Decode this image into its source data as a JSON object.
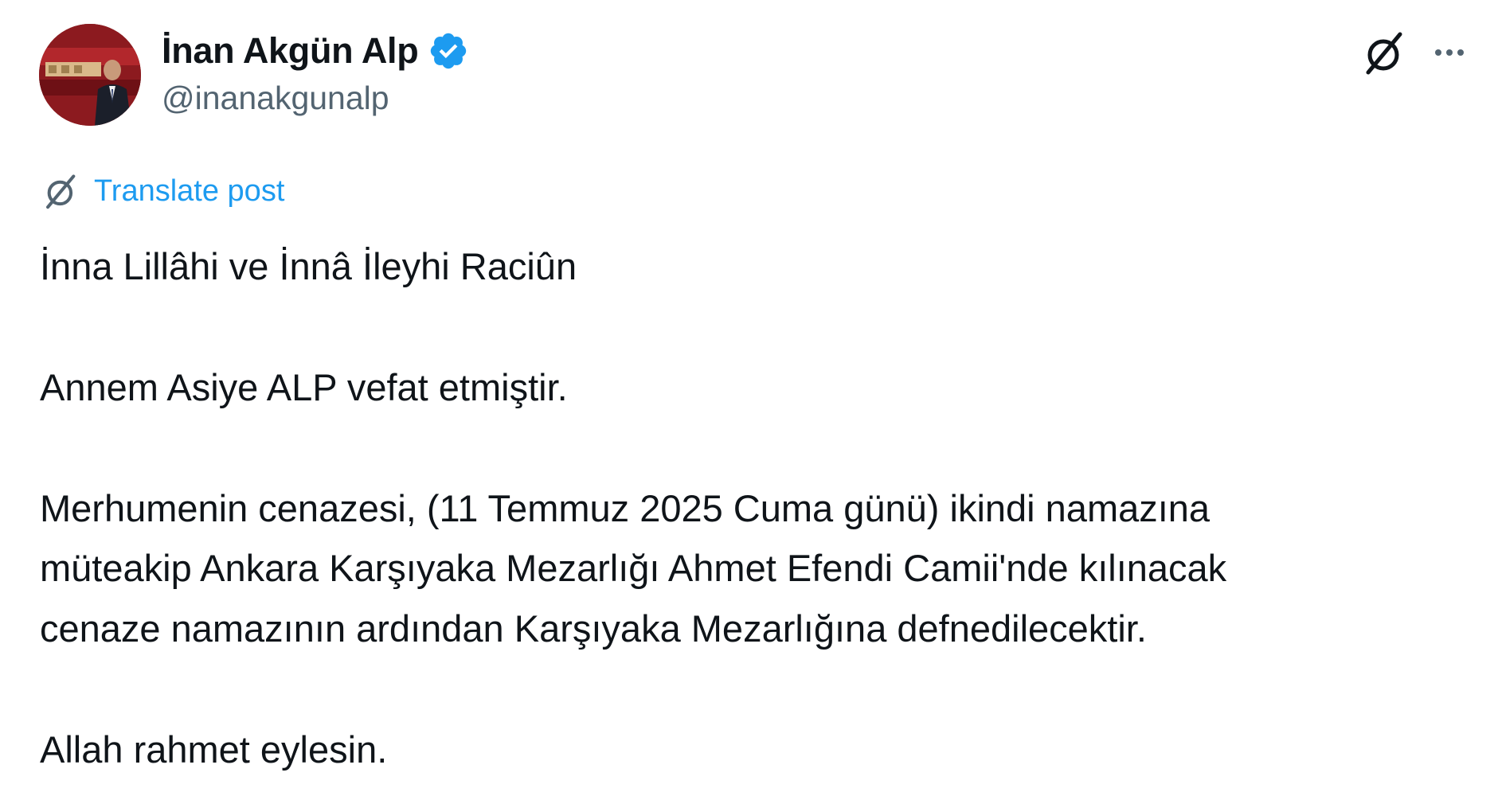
{
  "author": {
    "name": "İnan Akgün Alp",
    "handle": "@inanakgunalp",
    "verified": true,
    "avatar_icon": "profile-photo"
  },
  "actions": {
    "grok_icon": "grok-icon",
    "more_icon": "more-horizontal-icon"
  },
  "translate": {
    "label": "Translate post",
    "icon": "grok-translate-icon"
  },
  "post": {
    "paragraph_1": "İnna Lillâhi ve İnnâ İleyhi Raciûn",
    "paragraph_2": "Annem Asiye ALP vefat etmiştir.",
    "paragraph_3_line_1": "Merhumenin cenazesi, (11 Temmuz 2025 Cuma günü) ikindi namazına",
    "paragraph_3_line_2": "müteakip Ankara Karşıyaka Mezarlığı Ahmet Efendi Camii'nde kılınacak",
    "paragraph_3_line_3": "cenaze namazının ardından Karşıyaka Mezarlığına defnedilecektir.",
    "paragraph_4": "Allah rahmet eylesin."
  },
  "colors": {
    "text": "#0f1419",
    "secondary": "#536471",
    "accent": "#1d9bf0"
  }
}
